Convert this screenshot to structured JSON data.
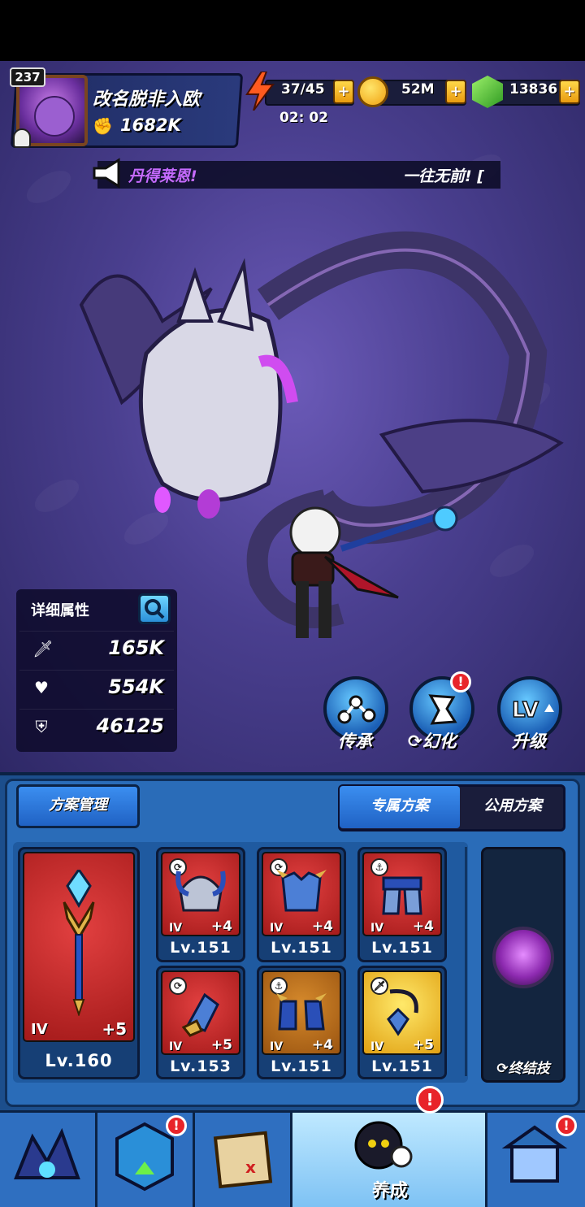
{
  "player": {
    "level": "237",
    "name": "改名脱非入欧",
    "power": "1682K"
  },
  "currencies": {
    "energy": "37/45",
    "energy_timer": "02: 02",
    "gold": "52M",
    "gems": "13836",
    "plus": "+"
  },
  "announcement": {
    "left": "丹得莱恩!",
    "right": "一往无前! ["
  },
  "attributes": {
    "title": "详细属性",
    "attack": "165K",
    "health": "554K",
    "defense": "46125"
  },
  "actions": {
    "inherit": "传承",
    "transform": "幻化",
    "upgrade": "升级",
    "alert": "!"
  },
  "loadout": {
    "manage_label": "方案管理",
    "tab_exclusive": "专属方案",
    "tab_public": "公用方案",
    "weapon": {
      "grade": "IV",
      "plus": "+5",
      "level": "Lv.160"
    },
    "slots": [
      {
        "grade": "IV",
        "plus": "+4",
        "level": "Lv.151",
        "type": "helmet"
      },
      {
        "grade": "IV",
        "plus": "+4",
        "level": "Lv.151",
        "type": "armor"
      },
      {
        "grade": "IV",
        "plus": "+4",
        "level": "Lv.151",
        "type": "pants"
      },
      {
        "grade": "IV",
        "plus": "+5",
        "level": "Lv.153",
        "type": "gloves"
      },
      {
        "grade": "IV",
        "plus": "+4",
        "level": "Lv.151",
        "type": "boots"
      },
      {
        "grade": "IV",
        "plus": "+5",
        "level": "Lv.151",
        "type": "necklace"
      }
    ],
    "ultimate_label": "终结技"
  },
  "nav": {
    "active_label": "养成",
    "alert": "!"
  },
  "colors": {
    "accent_blue": "#2a6cb8",
    "gold": "#f0a010",
    "alert_red": "#e8242a",
    "announce_purple": "#c66bff"
  }
}
